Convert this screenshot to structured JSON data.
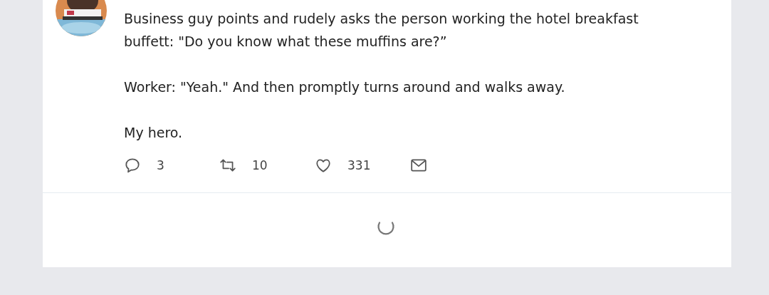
{
  "tweet": {
    "paragraphs": [
      "Business guy points and rudely asks the person working the hotel breakfast buffett: \"Do you know what these muffins are?”",
      "Worker: \"Yeah.\" And then promptly turns around and walks away.",
      "My hero."
    ],
    "actions": [
      {
        "kind": "reply",
        "count": "3"
      },
      {
        "kind": "retweet",
        "count": "10"
      },
      {
        "kind": "like",
        "count": "331"
      },
      {
        "kind": "message"
      }
    ]
  },
  "loading": true
}
